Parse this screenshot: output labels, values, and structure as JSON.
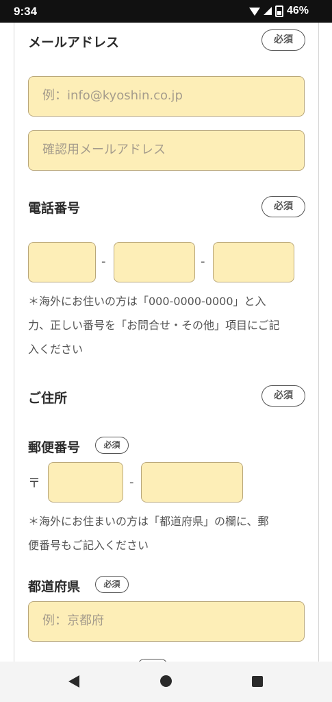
{
  "status_bar": {
    "time": "9:34",
    "battery": "46%",
    "icons": [
      "wifi-icon",
      "signal-icon",
      "battery-icon"
    ]
  },
  "required_badge": "必須",
  "email": {
    "label": "メールアドレス",
    "placeholder": "例：info@kyoshin.co.jp",
    "confirm_placeholder": "確認用メールアドレス"
  },
  "phone": {
    "label": "電話番号",
    "separator": "-",
    "note_lines": [
      "＊海外にお住いの方は「000-0000-0000」と入",
      "力、正しい番号を「お問合せ・その他」項目にご記",
      "入ください"
    ]
  },
  "address": {
    "label": "ご住所"
  },
  "postal": {
    "label": "郵便番号",
    "mark": "〒",
    "separator": "-",
    "note_lines": [
      "＊海外にお住まいの方は「都道府県」の欄に、郵",
      "便番号もご記入ください"
    ]
  },
  "prefecture": {
    "label": "都道府県",
    "placeholder": "例：京都府"
  },
  "colors": {
    "field_bg": "#fdeeb7",
    "field_border": "#b9a77a",
    "status_bar": "#111111"
  }
}
